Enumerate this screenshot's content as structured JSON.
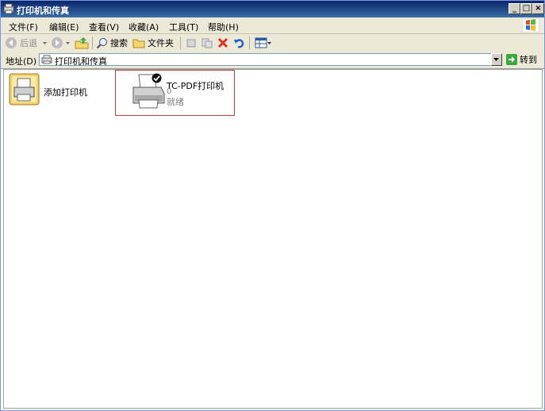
{
  "window": {
    "title": "打印机和传真",
    "controls": {
      "minimize": "_",
      "maximize": "□",
      "close": "×"
    }
  },
  "menubar": {
    "items": [
      "文件(F)",
      "编辑(E)",
      "查看(V)",
      "收藏(A)",
      "工具(T)",
      "帮助(H)"
    ]
  },
  "toolbar": {
    "back_label": "后退",
    "search_label": "搜索",
    "folders_label": "文件夹"
  },
  "addressbar": {
    "label": "地址(D)",
    "value": "打印机和传真",
    "go_label": "转到"
  },
  "content": {
    "items": [
      {
        "label": "添加打印机",
        "icon": "add-printer-icon"
      },
      {
        "label": "TC-PDF打印机",
        "count": "0",
        "status": "就绪",
        "icon": "printer-icon",
        "default": true
      }
    ]
  },
  "colors": {
    "titlebar": "#0a246a",
    "chrome": "#ece9d8",
    "selection_border": "#c04040"
  }
}
